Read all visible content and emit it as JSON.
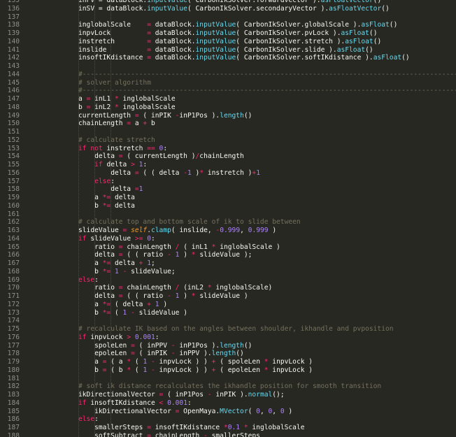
{
  "theme": {
    "background": "#272822",
    "text": "#f8f8f2",
    "keyword": "#f92672",
    "function": "#66d9ef",
    "number": "#ae81ff",
    "comment": "#75715e",
    "self": "#fd971f"
  },
  "lines": [
    {
      "n": "135",
      "tokens": [
        [
          "p",
          "inFV = dataBlock."
        ],
        [
          "f",
          "inputValue"
        ],
        [
          "p",
          "( CarbonIkSolver.forwardVector )."
        ],
        [
          "f",
          "asFloatVector"
        ],
        [
          "p",
          "()"
        ]
      ]
    },
    {
      "n": "136",
      "tokens": [
        [
          "p",
          "inSV = dataBlock."
        ],
        [
          "f",
          "inputValue"
        ],
        [
          "p",
          "( CarbonIkSolver.secondaryVector )."
        ],
        [
          "f",
          "asFloatVector"
        ],
        [
          "p",
          "()"
        ]
      ]
    },
    {
      "n": "137",
      "tokens": []
    },
    {
      "n": "138",
      "tokens": [
        [
          "p",
          "inglobalScale    "
        ],
        [
          "o",
          "="
        ],
        [
          "p",
          " dataBlock."
        ],
        [
          "f",
          "inputValue"
        ],
        [
          "p",
          "( CarbonIkSolver.globalScale )."
        ],
        [
          "f",
          "asFloat"
        ],
        [
          "p",
          "()"
        ]
      ]
    },
    {
      "n": "139",
      "tokens": [
        [
          "p",
          "inpvLock         "
        ],
        [
          "o",
          "="
        ],
        [
          "p",
          " dataBlock."
        ],
        [
          "f",
          "inputValue"
        ],
        [
          "p",
          "( CarbonIkSolver.pvLock )."
        ],
        [
          "f",
          "asFloat"
        ],
        [
          "p",
          "()"
        ]
      ]
    },
    {
      "n": "140",
      "tokens": [
        [
          "p",
          "instretch        "
        ],
        [
          "o",
          "="
        ],
        [
          "p",
          " dataBlock."
        ],
        [
          "f",
          "inputValue"
        ],
        [
          "p",
          "( CarbonIkSolver.stretch )."
        ],
        [
          "f",
          "asFloat"
        ],
        [
          "p",
          "()"
        ]
      ]
    },
    {
      "n": "141",
      "tokens": [
        [
          "p",
          "inslide          "
        ],
        [
          "o",
          "="
        ],
        [
          "p",
          " dataBlock."
        ],
        [
          "f",
          "inputValue"
        ],
        [
          "p",
          "( CarbonIkSolver.slide )."
        ],
        [
          "f",
          "asFloat"
        ],
        [
          "p",
          "()"
        ]
      ]
    },
    {
      "n": "142",
      "tokens": [
        [
          "p",
          "insoftIKdistance "
        ],
        [
          "o",
          "="
        ],
        [
          "p",
          " dataBlock."
        ],
        [
          "f",
          "inputValue"
        ],
        [
          "p",
          "( CarbonIkSolver.softIKdistance )."
        ],
        [
          "f",
          "asFloat"
        ],
        [
          "p",
          "()"
        ]
      ]
    },
    {
      "n": "143",
      "tokens": []
    },
    {
      "n": "144",
      "tokens": [
        [
          "c",
          "#------------------------------------------------------------------------------------------------------------------------------------"
        ]
      ]
    },
    {
      "n": "145",
      "tokens": [
        [
          "c",
          "# solver algorithm"
        ]
      ]
    },
    {
      "n": "146",
      "tokens": [
        [
          "c",
          "#------------------------------------------------------------------------------------------------------------------------------------"
        ]
      ]
    },
    {
      "n": "147",
      "tokens": [
        [
          "p",
          "a "
        ],
        [
          "o",
          "="
        ],
        [
          "p",
          " inL1 "
        ],
        [
          "o",
          "*"
        ],
        [
          "p",
          " inglobalScale"
        ]
      ]
    },
    {
      "n": "148",
      "tokens": [
        [
          "p",
          "b "
        ],
        [
          "o",
          "="
        ],
        [
          "p",
          " inL2 "
        ],
        [
          "o",
          "*"
        ],
        [
          "p",
          " inglobalScale"
        ]
      ]
    },
    {
      "n": "149",
      "tokens": [
        [
          "p",
          "currentLength "
        ],
        [
          "o",
          "="
        ],
        [
          "p",
          " ( inPIK "
        ],
        [
          "o",
          "-"
        ],
        [
          "p",
          "inP1Pos )."
        ],
        [
          "f",
          "length"
        ],
        [
          "p",
          "()"
        ]
      ]
    },
    {
      "n": "150",
      "tokens": [
        [
          "p",
          "chainLength "
        ],
        [
          "o",
          "="
        ],
        [
          "p",
          " a "
        ],
        [
          "o",
          "+"
        ],
        [
          "p",
          " b"
        ]
      ]
    },
    {
      "n": "151",
      "tokens": []
    },
    {
      "n": "152",
      "tokens": [
        [
          "c",
          "# calculate stretch"
        ]
      ]
    },
    {
      "n": "153",
      "tokens": [
        [
          "k",
          "if not"
        ],
        [
          "p",
          " instretch "
        ],
        [
          "o",
          "=="
        ],
        [
          "p",
          " "
        ],
        [
          "n",
          "0"
        ],
        [
          "p",
          ":"
        ]
      ]
    },
    {
      "n": "154",
      "tokens": [
        [
          "p",
          "    delta "
        ],
        [
          "o",
          "="
        ],
        [
          "p",
          " ( currentLength )"
        ],
        [
          "o",
          "/"
        ],
        [
          "p",
          "chainLength"
        ]
      ]
    },
    {
      "n": "155",
      "tokens": [
        [
          "p",
          "    "
        ],
        [
          "k",
          "if"
        ],
        [
          "p",
          " delta "
        ],
        [
          "o",
          ">"
        ],
        [
          "p",
          " "
        ],
        [
          "n",
          "1"
        ],
        [
          "p",
          ":"
        ]
      ]
    },
    {
      "n": "156",
      "tokens": [
        [
          "p",
          "        delta "
        ],
        [
          "o",
          "="
        ],
        [
          "p",
          " ( ( delta "
        ],
        [
          "o",
          "-"
        ],
        [
          "n",
          "1"
        ],
        [
          "p",
          " )"
        ],
        [
          "o",
          "*"
        ],
        [
          "p",
          " instretch )"
        ],
        [
          "o",
          "+"
        ],
        [
          "n",
          "1"
        ]
      ]
    },
    {
      "n": "157",
      "tokens": [
        [
          "p",
          "    "
        ],
        [
          "k",
          "else"
        ],
        [
          "p",
          ":"
        ]
      ]
    },
    {
      "n": "158",
      "tokens": [
        [
          "p",
          "        delta "
        ],
        [
          "o",
          "="
        ],
        [
          "n",
          "1"
        ]
      ]
    },
    {
      "n": "159",
      "tokens": [
        [
          "p",
          "    a "
        ],
        [
          "o",
          "*="
        ],
        [
          "p",
          " delta"
        ]
      ]
    },
    {
      "n": "160",
      "tokens": [
        [
          "p",
          "    b "
        ],
        [
          "o",
          "*="
        ],
        [
          "p",
          " delta"
        ]
      ]
    },
    {
      "n": "161",
      "tokens": []
    },
    {
      "n": "162",
      "tokens": [
        [
          "c",
          "# calculate top and bottom scale of ik to slide between"
        ]
      ]
    },
    {
      "n": "163",
      "tokens": [
        [
          "p",
          "slideValue "
        ],
        [
          "o",
          "="
        ],
        [
          "p",
          " "
        ],
        [
          "s",
          "self"
        ],
        [
          "p",
          "."
        ],
        [
          "f",
          "clamp"
        ],
        [
          "p",
          "( inslide, "
        ],
        [
          "o",
          "-"
        ],
        [
          "n",
          "0.999"
        ],
        [
          "p",
          ", "
        ],
        [
          "n",
          "0.999"
        ],
        [
          "p",
          " )"
        ]
      ]
    },
    {
      "n": "164",
      "tokens": [
        [
          "k",
          "if"
        ],
        [
          "p",
          " slideValue "
        ],
        [
          "o",
          ">="
        ],
        [
          "p",
          " "
        ],
        [
          "n",
          "0"
        ],
        [
          "p",
          ":"
        ]
      ]
    },
    {
      "n": "165",
      "tokens": [
        [
          "p",
          "    ratio "
        ],
        [
          "o",
          "="
        ],
        [
          "p",
          " chainLength "
        ],
        [
          "o",
          "/"
        ],
        [
          "p",
          " ( inL1 "
        ],
        [
          "o",
          "*"
        ],
        [
          "p",
          " inglobalScale )"
        ]
      ]
    },
    {
      "n": "166",
      "tokens": [
        [
          "p",
          "    delta "
        ],
        [
          "o",
          "="
        ],
        [
          "p",
          " ( ( ratio "
        ],
        [
          "o",
          "-"
        ],
        [
          "p",
          " "
        ],
        [
          "n",
          "1"
        ],
        [
          "p",
          " ) "
        ],
        [
          "o",
          "*"
        ],
        [
          "p",
          " slideValue );"
        ]
      ]
    },
    {
      "n": "167",
      "tokens": [
        [
          "p",
          "    a "
        ],
        [
          "o",
          "*="
        ],
        [
          "p",
          " delta "
        ],
        [
          "o",
          "+"
        ],
        [
          "p",
          " "
        ],
        [
          "n",
          "1"
        ],
        [
          "p",
          ";"
        ]
      ]
    },
    {
      "n": "168",
      "tokens": [
        [
          "p",
          "    b "
        ],
        [
          "o",
          "*="
        ],
        [
          "p",
          " "
        ],
        [
          "n",
          "1"
        ],
        [
          "p",
          " "
        ],
        [
          "o",
          "-"
        ],
        [
          "p",
          " slideValue;"
        ]
      ]
    },
    {
      "n": "169",
      "tokens": [
        [
          "k",
          "else"
        ],
        [
          "p",
          ":"
        ]
      ]
    },
    {
      "n": "170",
      "tokens": [
        [
          "p",
          "    ratio "
        ],
        [
          "o",
          "="
        ],
        [
          "p",
          " chainLength "
        ],
        [
          "o",
          "/"
        ],
        [
          "p",
          " (inL2 "
        ],
        [
          "o",
          "*"
        ],
        [
          "p",
          " inglobalScale)"
        ]
      ]
    },
    {
      "n": "171",
      "tokens": [
        [
          "p",
          "    delta "
        ],
        [
          "o",
          "="
        ],
        [
          "p",
          " ( ( ratio "
        ],
        [
          "o",
          "-"
        ],
        [
          "p",
          " "
        ],
        [
          "n",
          "1"
        ],
        [
          "p",
          " ) "
        ],
        [
          "o",
          "*"
        ],
        [
          "p",
          " slideValue )"
        ]
      ]
    },
    {
      "n": "172",
      "tokens": [
        [
          "p",
          "    a "
        ],
        [
          "o",
          "*="
        ],
        [
          "p",
          " ( delta "
        ],
        [
          "o",
          "+"
        ],
        [
          "p",
          " "
        ],
        [
          "n",
          "1"
        ],
        [
          "p",
          " )"
        ]
      ]
    },
    {
      "n": "173",
      "tokens": [
        [
          "p",
          "    b "
        ],
        [
          "o",
          "*="
        ],
        [
          "p",
          " ( "
        ],
        [
          "n",
          "1"
        ],
        [
          "p",
          " "
        ],
        [
          "o",
          "-"
        ],
        [
          "p",
          " slideValue )"
        ]
      ]
    },
    {
      "n": "174",
      "tokens": []
    },
    {
      "n": "175",
      "tokens": [
        [
          "c",
          "# recalculate IK based on the angles between shoulder, ikhandle and pvposition"
        ]
      ]
    },
    {
      "n": "176",
      "tokens": [
        [
          "k",
          "if"
        ],
        [
          "p",
          " inpvLock "
        ],
        [
          "o",
          ">"
        ],
        [
          "p",
          " "
        ],
        [
          "n",
          "0.001"
        ],
        [
          "p",
          ":"
        ]
      ]
    },
    {
      "n": "177",
      "tokens": [
        [
          "p",
          "    spoleLen "
        ],
        [
          "o",
          "="
        ],
        [
          "p",
          " ( inPPV "
        ],
        [
          "o",
          "-"
        ],
        [
          "p",
          " inP1Pos )."
        ],
        [
          "f",
          "length"
        ],
        [
          "p",
          "()"
        ]
      ]
    },
    {
      "n": "178",
      "tokens": [
        [
          "p",
          "    epoleLen "
        ],
        [
          "o",
          "="
        ],
        [
          "p",
          " ( inPIK "
        ],
        [
          "o",
          "-"
        ],
        [
          "p",
          " inPPV )."
        ],
        [
          "f",
          "length"
        ],
        [
          "p",
          "()"
        ]
      ]
    },
    {
      "n": "179",
      "tokens": [
        [
          "p",
          "    a "
        ],
        [
          "o",
          "="
        ],
        [
          "p",
          " ( a "
        ],
        [
          "o",
          "*"
        ],
        [
          "p",
          " ( "
        ],
        [
          "n",
          "1"
        ],
        [
          "p",
          " "
        ],
        [
          "o",
          "-"
        ],
        [
          "p",
          " inpvLock ) ) "
        ],
        [
          "o",
          "+"
        ],
        [
          "p",
          " ( spoleLen "
        ],
        [
          "o",
          "*"
        ],
        [
          "p",
          " inpvLock )"
        ]
      ]
    },
    {
      "n": "180",
      "tokens": [
        [
          "p",
          "    b "
        ],
        [
          "o",
          "="
        ],
        [
          "p",
          " ( b "
        ],
        [
          "o",
          "*"
        ],
        [
          "p",
          " ( "
        ],
        [
          "n",
          "1"
        ],
        [
          "p",
          " "
        ],
        [
          "o",
          "-"
        ],
        [
          "p",
          " inpvLock ) ) "
        ],
        [
          "o",
          "+"
        ],
        [
          "p",
          " ( epoleLen "
        ],
        [
          "o",
          "*"
        ],
        [
          "p",
          " inpvLock )"
        ]
      ]
    },
    {
      "n": "181",
      "tokens": []
    },
    {
      "n": "182",
      "tokens": [
        [
          "c",
          "# soft ik distance recalculates the ikhandle position for smooth transition"
        ]
      ]
    },
    {
      "n": "183",
      "tokens": [
        [
          "p",
          "ikDirectionalVector "
        ],
        [
          "o",
          "="
        ],
        [
          "p",
          " ( inP1Pos "
        ],
        [
          "o",
          "-"
        ],
        [
          "p",
          " inPIK )."
        ],
        [
          "f",
          "normal"
        ],
        [
          "p",
          "();"
        ]
      ]
    },
    {
      "n": "184",
      "tokens": [
        [
          "k",
          "if"
        ],
        [
          "p",
          " insoftIKdistance "
        ],
        [
          "o",
          "<"
        ],
        [
          "p",
          " "
        ],
        [
          "n",
          "0.001"
        ],
        [
          "p",
          ":"
        ]
      ]
    },
    {
      "n": "185",
      "tokens": [
        [
          "p",
          "    ikDirectionalVector "
        ],
        [
          "o",
          "="
        ],
        [
          "p",
          " OpenMaya."
        ],
        [
          "f",
          "MVector"
        ],
        [
          "p",
          "( "
        ],
        [
          "n",
          "0"
        ],
        [
          "p",
          ", "
        ],
        [
          "n",
          "0"
        ],
        [
          "p",
          ", "
        ],
        [
          "n",
          "0"
        ],
        [
          "p",
          " )"
        ]
      ]
    },
    {
      "n": "186",
      "tokens": [
        [
          "k",
          "else"
        ],
        [
          "p",
          ":"
        ]
      ]
    },
    {
      "n": "187",
      "tokens": [
        [
          "p",
          "    smallerSteps "
        ],
        [
          "o",
          "="
        ],
        [
          "p",
          " insoftIKdistance "
        ],
        [
          "o",
          "*"
        ],
        [
          "n",
          "0.1"
        ],
        [
          "p",
          " "
        ],
        [
          "o",
          "*"
        ],
        [
          "p",
          " inglobalScale"
        ]
      ]
    },
    {
      "n": "188",
      "tokens": [
        [
          "p",
          "    softSubtract "
        ],
        [
          "o",
          "="
        ],
        [
          "p",
          " chainLength "
        ],
        [
          "o",
          "-"
        ],
        [
          "p",
          " smallerSteps"
        ]
      ]
    }
  ]
}
